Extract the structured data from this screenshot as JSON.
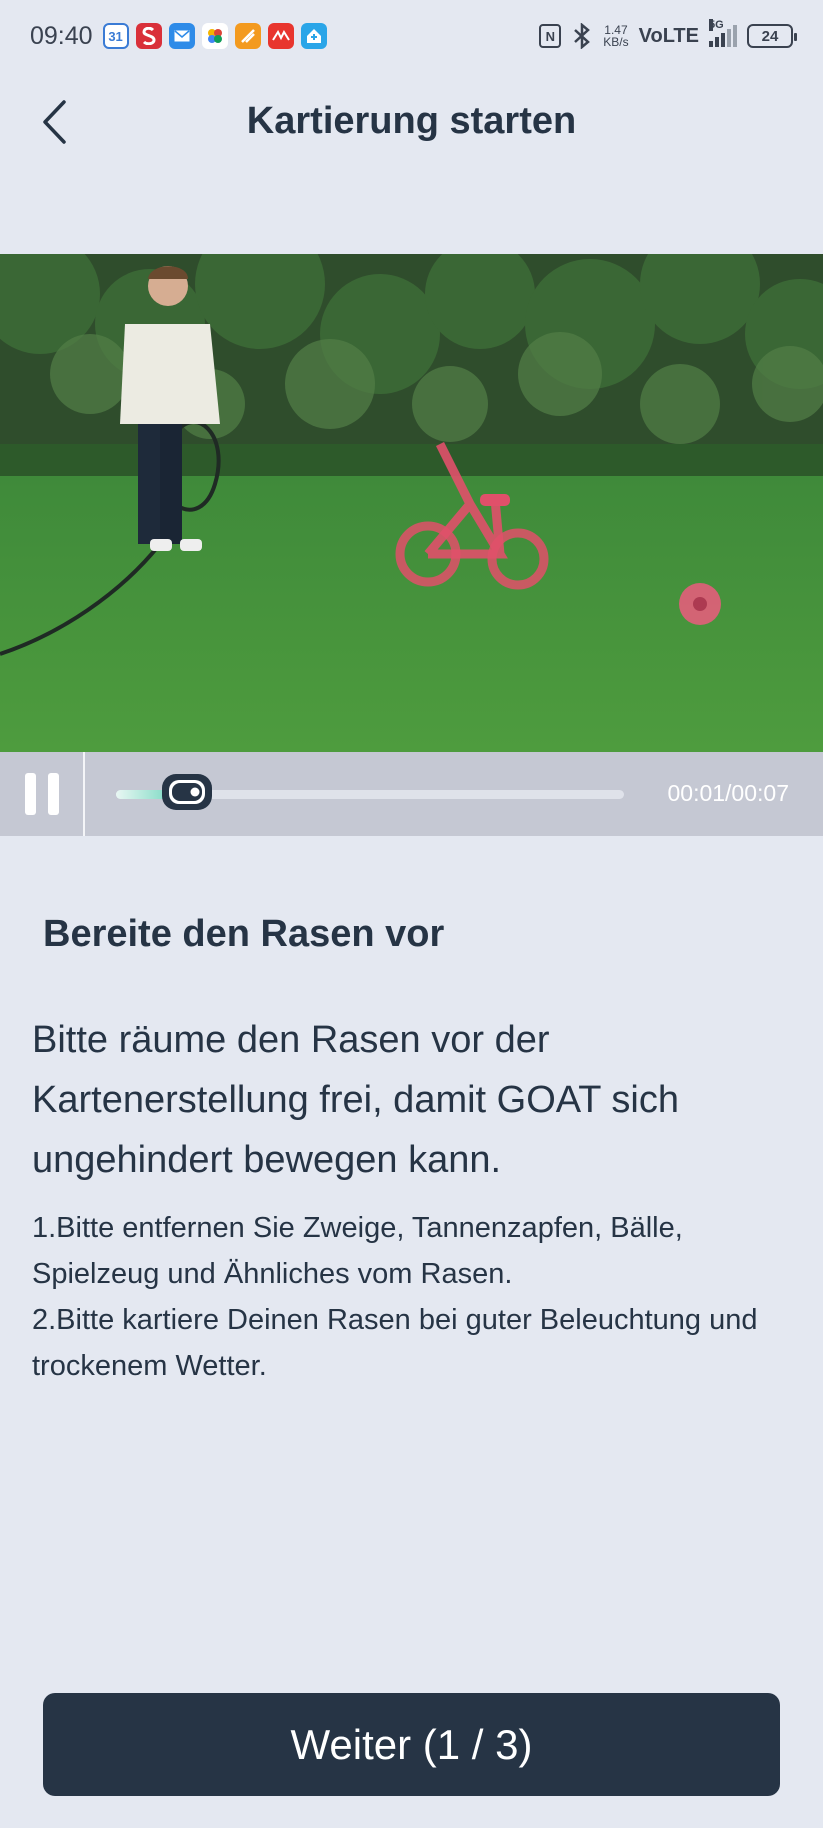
{
  "status_bar": {
    "time": "09:40",
    "calendar_day": "31",
    "speed_value": "1.47",
    "speed_unit": "KB/s",
    "network": "VoLTE",
    "signal_label": "5G",
    "battery": "24"
  },
  "header": {
    "title": "Kartierung starten"
  },
  "player": {
    "time": "00:01/00:07",
    "progress": 0.14,
    "accent": "#5fd1b6"
  },
  "content": {
    "section_title": "Bereite den Rasen vor",
    "intro": "Bitte räume den Rasen vor der Kartenerstellung frei, damit GOAT sich ungehindert bewegen kann.",
    "instructions": [
      "1.Bitte entfernen Sie Zweige, Tannenzapfen, Bälle, Spielzeug und Ähnliches vom Rasen.",
      "2.Bitte kartiere Deinen Rasen bei guter Beleuchtung und trockenem Wetter."
    ]
  },
  "footer": {
    "next_label": "Weiter (1 / 3)"
  },
  "colors": {
    "background": "#e4e8f1",
    "primary": "#263445",
    "highlight_overlay": "#e0506a"
  }
}
